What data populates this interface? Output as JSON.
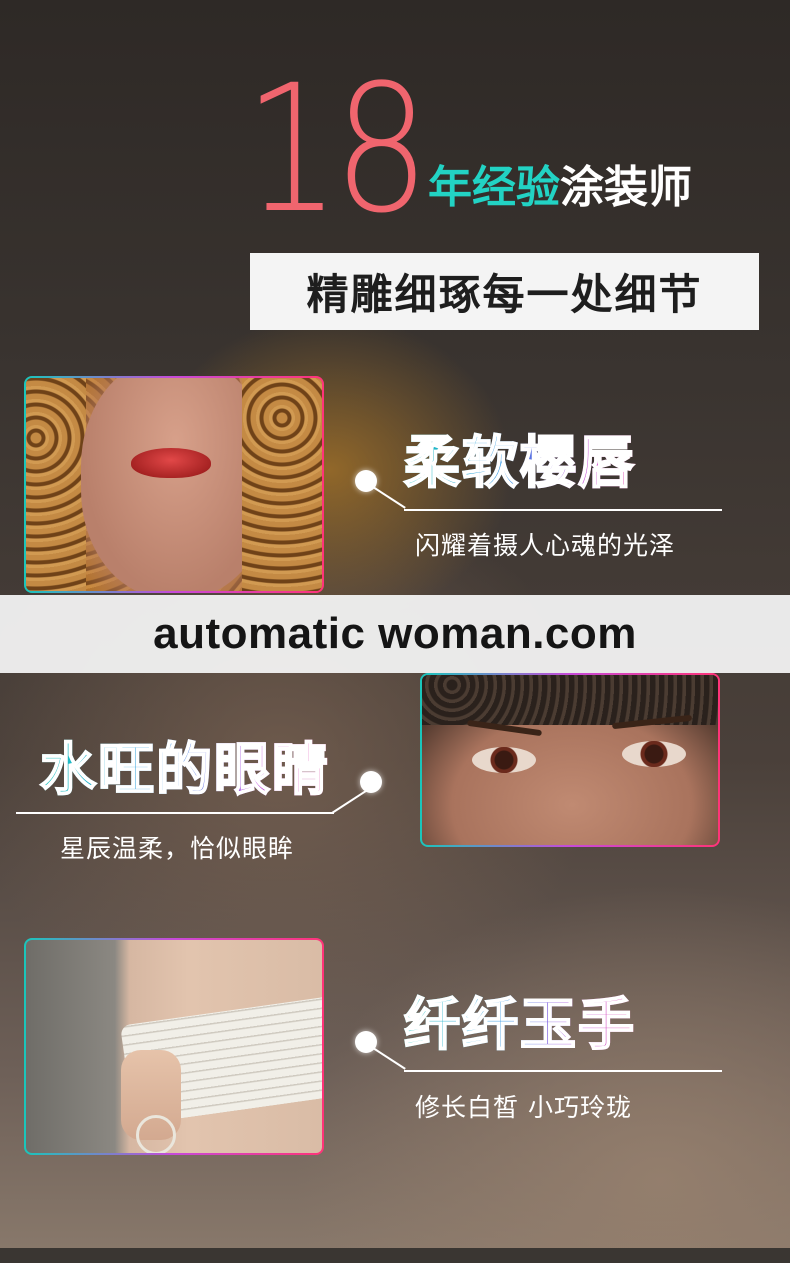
{
  "hero": {
    "number": "18",
    "accent": "年经验",
    "rest": "涂装师"
  },
  "subtitle": "精雕细琢每一处细节",
  "features": [
    {
      "title": "柔软樱唇",
      "caption": "闪耀着摄人心魂的光泽",
      "photo": "lips-photo"
    },
    {
      "title": "水旺的眼睛",
      "caption": "星辰温柔，恰似眼眸",
      "photo": "eyes-photo"
    },
    {
      "title": "纤纤玉手",
      "caption": "修长白皙  小巧玲珑",
      "photo": "hand-photo"
    }
  ],
  "watermark": "automatic woman.com",
  "colors": {
    "hero_number": "#f0656e",
    "accent": "#22d3c4",
    "frame_gradient": [
      "#19c6bb",
      "#c74ad9",
      "#ff3478"
    ],
    "watermark_bg": "#f0f0f0"
  }
}
